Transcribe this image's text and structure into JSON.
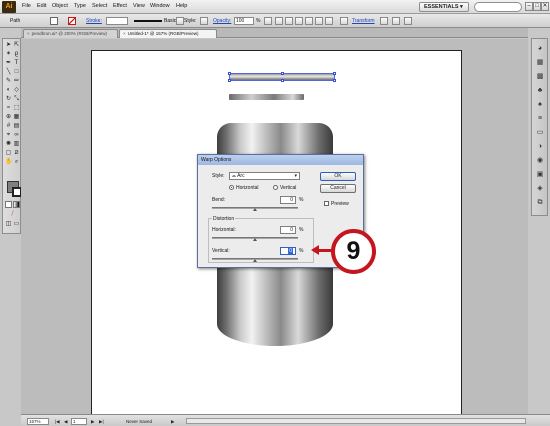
{
  "app": {
    "logo": "Ai"
  },
  "menu": [
    "File",
    "Edit",
    "Object",
    "Type",
    "Select",
    "Effect",
    "View",
    "Window",
    "Help"
  ],
  "workspace": {
    "label": "ESSENTIALS ▾"
  },
  "window_controls": {
    "minimize": "–",
    "maximize": "□",
    "close": "✕"
  },
  "control_bar": {
    "selection_type": "Path",
    "stroke_label": "Stroke:",
    "stroke_style": "Basic",
    "style_label": "Style:",
    "opacity_label": "Opacity:",
    "opacity_value": "100",
    "opacity_unit": "%",
    "transform_label": "Transform"
  },
  "tabs": [
    {
      "label": "pendbrun.ai* @ 200% (RGB/Preview)",
      "close": "×"
    },
    {
      "label": "Untitled-1* @ 157% (RGB/Preview)",
      "close": "×"
    }
  ],
  "dialog": {
    "title": "Warp Options",
    "style_label": "Style:",
    "style_value": "Arc",
    "orientation_horizontal": "Horizontal",
    "orientation_vertical": "Vertical",
    "bend_label": "Bend:",
    "bend_value": "0",
    "distortion_label": "Distortion",
    "horizontal_label": "Horizontal:",
    "horizontal_value": "0",
    "vertical_label": "Vertical:",
    "vertical_value": "0",
    "percent": "%",
    "ok_label": "OK",
    "cancel_label": "Cancel",
    "preview_label": "Preview"
  },
  "callout": {
    "number": "9"
  },
  "status_bar": {
    "zoom": "157%",
    "artboard": "1",
    "status": "Never Saved"
  },
  "colors": {
    "callout_red": "#c4161c",
    "selection_blue": "#3250d0",
    "dialog_title": "#a9c0e8"
  }
}
